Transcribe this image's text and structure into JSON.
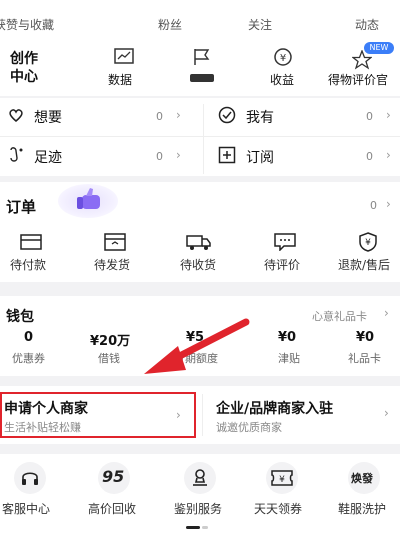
{
  "top_stats": [
    "获赞与收藏",
    "粉丝",
    "关注",
    "动态"
  ],
  "creator": {
    "title_line1": "创作",
    "title_line2": "中心",
    "items": [
      {
        "label": "数据",
        "icon": "chart-icon"
      },
      {
        "label": "",
        "icon": "flag-icon"
      },
      {
        "label": "收益",
        "icon": "yen-coin-icon"
      },
      {
        "label": "得物评价官",
        "icon": "star-icon",
        "badge": "NEW"
      }
    ]
  },
  "quick": [
    {
      "label": "想要",
      "count": "0",
      "icon": "heart-icon"
    },
    {
      "label": "我有",
      "count": "0",
      "icon": "check-circle-icon"
    },
    {
      "label": "足迹",
      "count": "0",
      "icon": "footprint-icon"
    },
    {
      "label": "订阅",
      "count": "0",
      "icon": "add-box-icon"
    }
  ],
  "orders": {
    "title": "订单",
    "count": "0",
    "items": [
      {
        "label": "待付款",
        "icon": "card-icon"
      },
      {
        "label": "待发货",
        "icon": "box-icon"
      },
      {
        "label": "待收货",
        "icon": "truck-icon"
      },
      {
        "label": "待评价",
        "icon": "comment-icon"
      },
      {
        "label": "退款/售后",
        "icon": "shield-yen-icon"
      }
    ]
  },
  "wallet": {
    "title": "钱包",
    "gift_card": "心意礼品卡",
    "items": [
      {
        "value": "0",
        "label": "优惠券"
      },
      {
        "value": "¥20万",
        "label": "借钱"
      },
      {
        "value": "¥5",
        "label": "分期额度"
      },
      {
        "value": "¥0",
        "label": "津贴"
      },
      {
        "value": "¥0",
        "label": "礼品卡"
      }
    ]
  },
  "merchant": {
    "personal_title": "申请个人商家",
    "personal_sub": "生活补贴轻松赚",
    "brand_title": "企业/品牌商家入驻",
    "brand_sub": "诚邀优质商家"
  },
  "services": [
    {
      "label": "客服中心",
      "icon": "headset-icon"
    },
    {
      "label": "高价回收",
      "icon": "recycle-95-icon"
    },
    {
      "label": "鉴别服务",
      "icon": "stamp-icon"
    },
    {
      "label": "天天领券",
      "icon": "ticket-icon"
    },
    {
      "label": "鞋服洗护",
      "icon": "wash-icon"
    }
  ],
  "colors": {
    "highlight": "#e0242c",
    "new_badge": "#3b7ef8"
  }
}
